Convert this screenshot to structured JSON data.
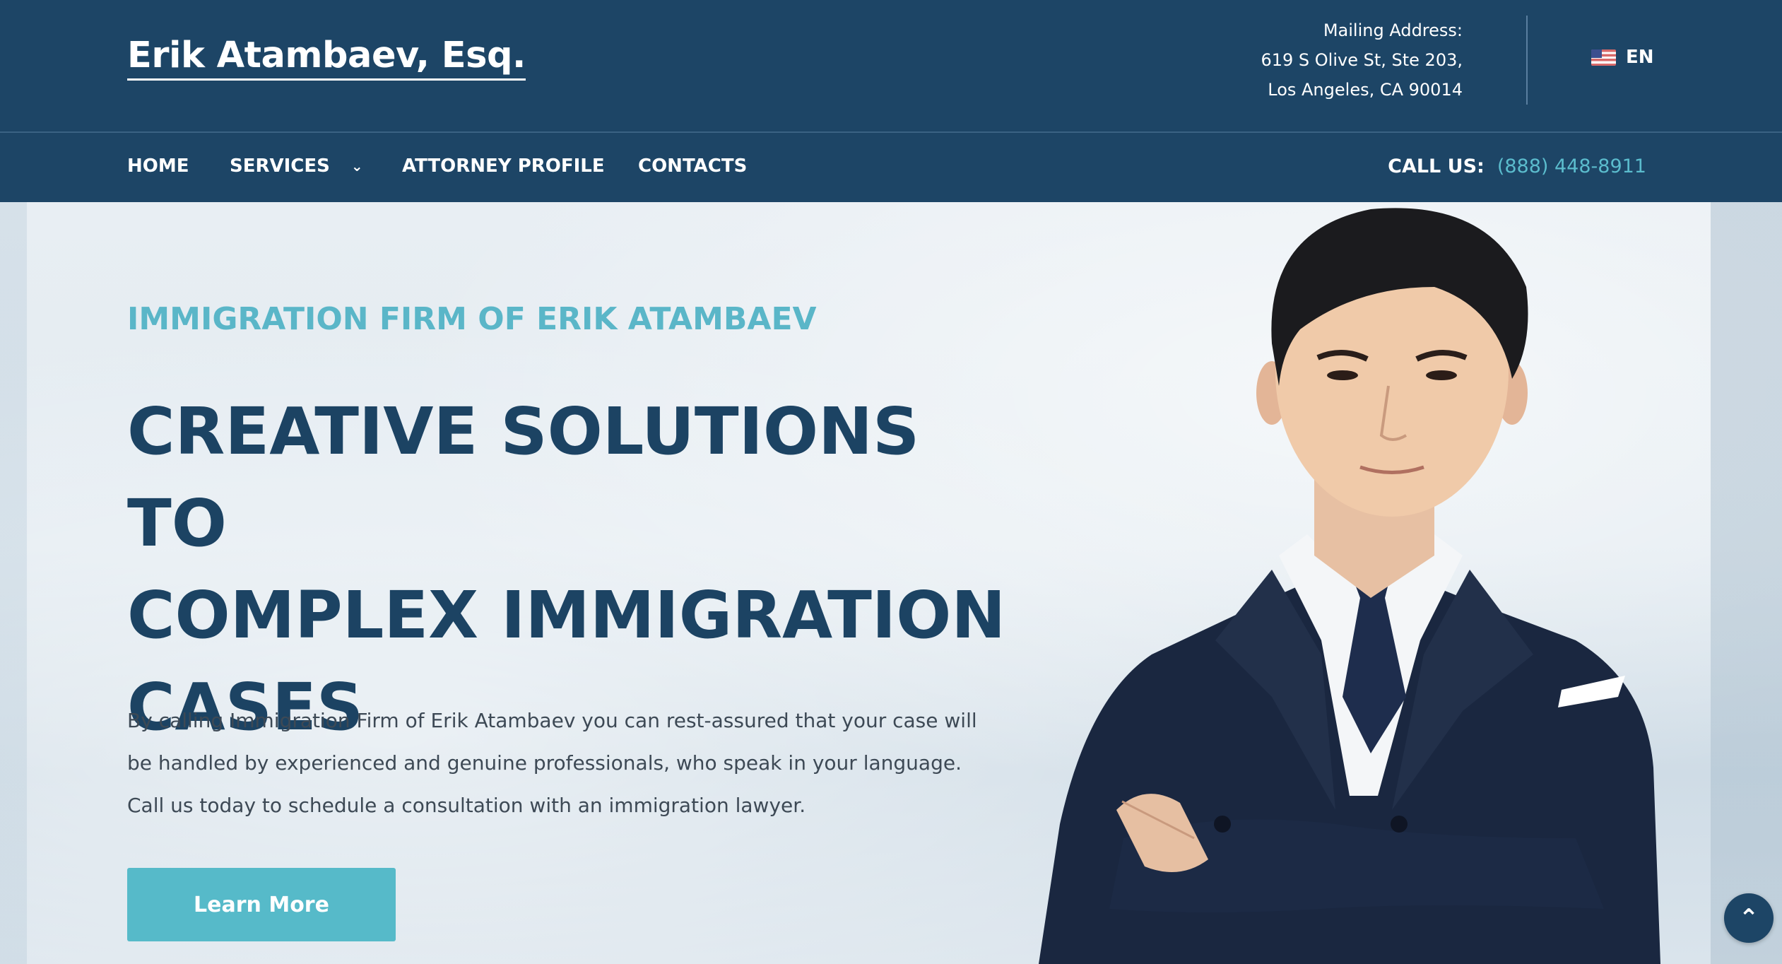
{
  "header": {
    "logo": "Erik Atambaev, Esq.",
    "mailing_label": "Mailing Address:",
    "mailing_line1": "619 S Olive St, Ste 203,",
    "mailing_line2": "Los Angeles, CA 90014",
    "language": "EN",
    "flag_icon": "us-flag-icon"
  },
  "nav": {
    "items": [
      {
        "label": "HOME"
      },
      {
        "label": "SERVICES",
        "has_dropdown": true
      },
      {
        "label": "ATTORNEY PROFILE"
      },
      {
        "label": "CONTACTS"
      }
    ],
    "call_label": "CALL US:",
    "phone": "(888) 448-8911"
  },
  "hero": {
    "eyebrow": "IMMIGRATION FIRM OF ERIK ATAMBAEV",
    "headline_line1": "CREATIVE SOLUTIONS TO",
    "headline_line2": "COMPLEX IMMIGRATION",
    "headline_line3": "CASES",
    "body_line1": "By calling Immigration Firm of Erik Atambaev you can rest-assured that your case will",
    "body_line2": "be handled by experienced and genuine professionals, who speak in your language.",
    "body_line3": "Call us today to schedule a consultation with an immigration lawyer.",
    "cta": "Learn More"
  },
  "colors": {
    "navy": "#1d4566",
    "accent": "#5ab6c8",
    "headline": "#1c4363"
  },
  "scroll_top_icon": "chevron-up-icon"
}
